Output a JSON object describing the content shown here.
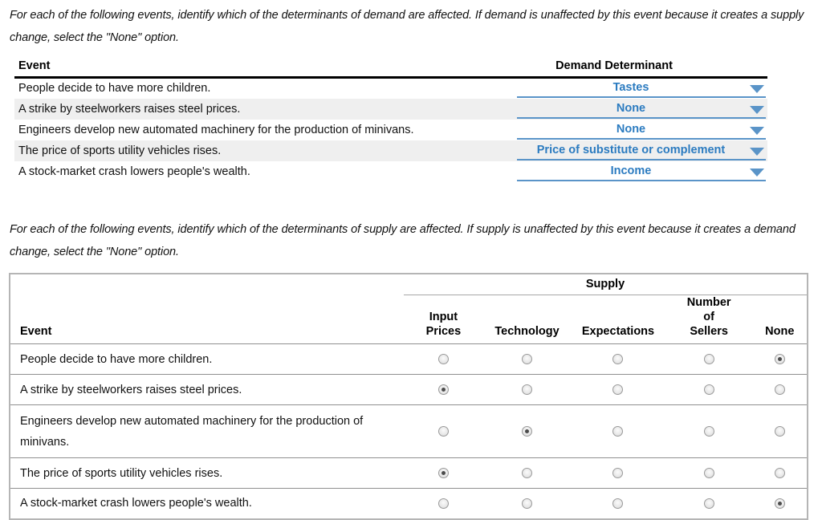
{
  "intro": {
    "demand": "For each of the following events, identify which of the determinants of demand are affected. If demand is unaffected by this event because it creates a supply change, select the \"None\" option.",
    "supply": "For each of the following events, identify which of the determinants of supply are affected. If supply is unaffected by this event because it creates a demand change, select the \"None\" option."
  },
  "demand_table": {
    "headers": {
      "event": "Event",
      "determinant": "Demand Determinant"
    },
    "rows": [
      {
        "event": "People decide to have more children.",
        "selected": "Tastes",
        "shaded": false
      },
      {
        "event": "A strike by steelworkers raises steel prices.",
        "selected": "None",
        "shaded": true
      },
      {
        "event": "Engineers develop new automated machinery for the production of minivans.",
        "selected": "None",
        "shaded": false
      },
      {
        "event": "The price of sports utility vehicles rises.",
        "selected": "Price of substitute or complement",
        "shaded": true
      },
      {
        "event": "A stock-market crash lowers people's wealth.",
        "selected": "Income",
        "shaded": false
      }
    ],
    "dropdown_icon": "chevron-down-icon"
  },
  "supply_table": {
    "group_header": "Supply",
    "headers": {
      "event": "Event",
      "columns": [
        "Input Prices",
        "Technology",
        "Expectations",
        "Number of Sellers",
        "None"
      ]
    },
    "rows": [
      {
        "event": "People decide to have more children.",
        "selected_index": 4
      },
      {
        "event": "A strike by steelworkers raises steel prices.",
        "selected_index": 0
      },
      {
        "event": "Engineers develop new automated machinery for the production of minivans.",
        "selected_index": 1
      },
      {
        "event": "The price of sports utility vehicles rises.",
        "selected_index": 0
      },
      {
        "event": "A stock-market crash lowers people's wealth.",
        "selected_index": 4
      }
    ]
  },
  "colors": {
    "accent_blue": "#2b7bc0",
    "underline_blue": "#5a94c8",
    "row_shade": "#efefef",
    "table_border": "#909090"
  }
}
